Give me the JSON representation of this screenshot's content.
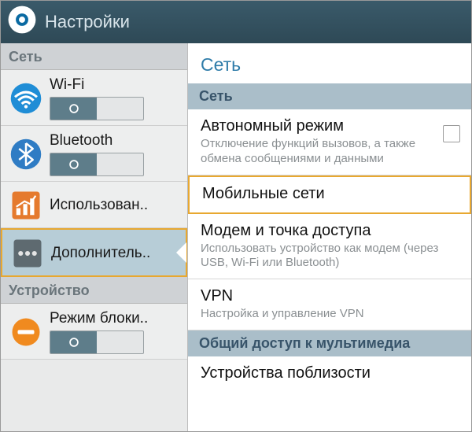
{
  "header": {
    "title": "Настройки"
  },
  "sidebar": {
    "section_network": "Сеть",
    "section_device": "Устройство",
    "wifi": "Wi-Fi",
    "bluetooth": "Bluetooth",
    "data_usage": "Использован..",
    "more": "Дополнитель..",
    "block_mode": "Режим блоки.."
  },
  "content": {
    "title": "Сеть",
    "section_network": "Сеть",
    "airplane": {
      "title": "Автономный режим",
      "sub": "Отключение функций вызовов, а также обмена сообщениями и данными"
    },
    "mobile_networks": "Мобильные сети",
    "tethering": {
      "title": "Модем и точка доступа",
      "sub": "Использовать устройство как модем (через USB, Wi-Fi или Bluetooth)"
    },
    "vpn": {
      "title": "VPN",
      "sub": "Настройка и управление VPN"
    },
    "section_media": "Общий доступ к мультимедиа",
    "nearby": "Устройства поблизости"
  }
}
